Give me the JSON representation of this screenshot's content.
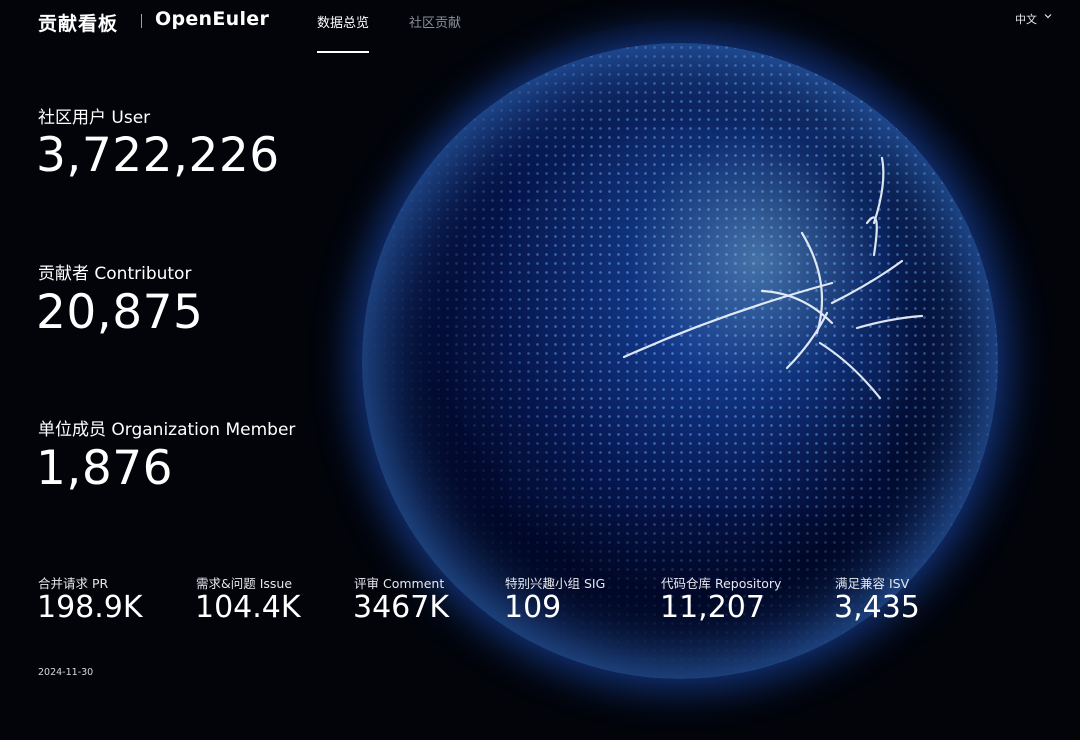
{
  "header": {
    "title": "贡献看板",
    "logo_text": "OpenEuler",
    "tabs": [
      {
        "label": "数据总览",
        "active": true
      },
      {
        "label": "社区贡献",
        "active": false
      }
    ],
    "language": "中文",
    "language_icon": "chevron-down-icon"
  },
  "stats": [
    {
      "label": "社区用户 User",
      "value": "3,722,226"
    },
    {
      "label": "贡献者 Contributor",
      "value": "20,875"
    },
    {
      "label": "单位成员 Organization Member",
      "value": "1,876"
    }
  ],
  "metrics": [
    {
      "label": "合并请求 PR",
      "value": "198.9K"
    },
    {
      "label": "需求&问题 Issue",
      "value": "104.4K"
    },
    {
      "label": "评审 Comment",
      "value": "3467K"
    },
    {
      "label": "特别兴趣小组 SIG",
      "value": "109"
    },
    {
      "label": "代码仓库 Repository",
      "value": "11,207"
    },
    {
      "label": "满足兼容 ISV",
      "value": "3,435"
    }
  ],
  "footer": {
    "date": "2024-11-30"
  },
  "colors": {
    "background": "#02040a",
    "globe_accent": "#2a6dff",
    "inactive_tab": "#8a8f99"
  }
}
